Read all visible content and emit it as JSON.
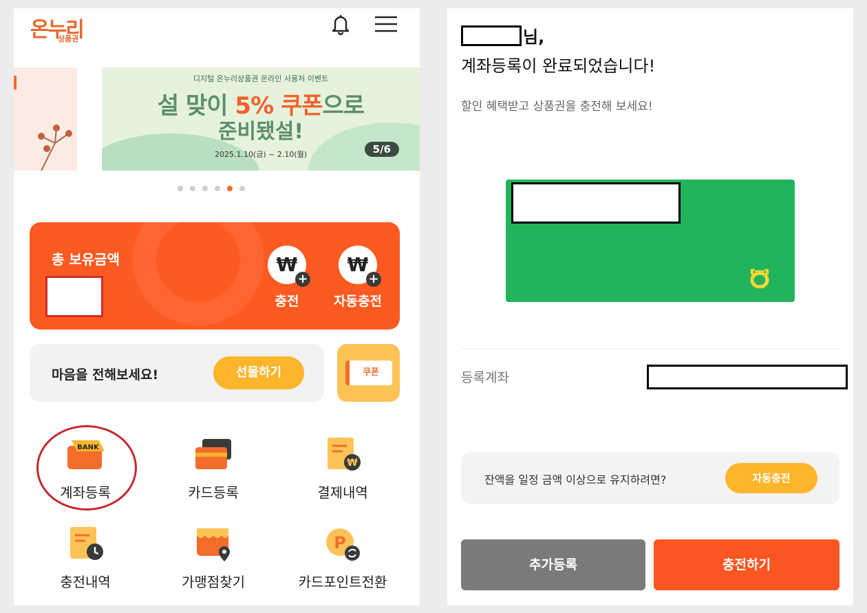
{
  "header": {
    "logo_text": "온누리",
    "logo_sub": "상품권"
  },
  "banner": {
    "event_text": "디지털 온누리상품권 온라인 사용처 이벤트",
    "headline_a": "설 맞이 ",
    "headline_hl": "5% 쿠폰",
    "headline_b": "으로",
    "headline2": "준비됐설!",
    "date": "2025.1.10(금) ~ 2.10(월)",
    "counter": "5/6",
    "dots_total": 6,
    "active_dot": 5
  },
  "balance": {
    "title": "총 보유금액",
    "currency_symbol": "₩",
    "charge_label": "충전",
    "auto_charge_label": "자동충전"
  },
  "gift": {
    "text": "마음을 전해보세요!",
    "button": "선물하기"
  },
  "coupon": {
    "label": "쿠폰"
  },
  "menu": {
    "items": [
      {
        "label": "계좌등록",
        "icon": "bank-icon",
        "icon_text": "BANK"
      },
      {
        "label": "카드등록",
        "icon": "card-icon"
      },
      {
        "label": "결제내역",
        "icon": "payment-history-icon"
      },
      {
        "label": "충전내역",
        "icon": "charge-history-icon"
      },
      {
        "label": "가맹점찾기",
        "icon": "store-finder-icon"
      },
      {
        "label": "카드포인트전환",
        "icon": "point-convert-icon",
        "icon_text": "P"
      }
    ]
  },
  "confirm": {
    "name_suffix": "님,",
    "title": "계좌등록이 완료되었습니다!",
    "subtitle": "할인 혜택받고 상품권을 충전해 보세요!",
    "account_label": "등록계좌",
    "info_text": "잔액을 일정 금액 이상으로 유지하려면?",
    "info_button": "자동충전",
    "add_button": "추가등록",
    "charge_button": "충전하기"
  },
  "colors": {
    "brand_orange": "#fd5a21",
    "accent_yellow": "#fdb52c",
    "card_green": "#22b45a",
    "highlight_red": "#c6282e"
  }
}
